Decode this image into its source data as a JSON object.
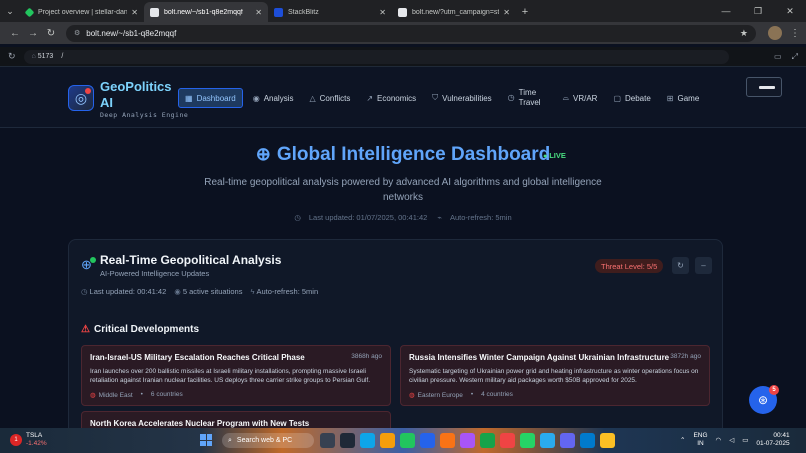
{
  "browser": {
    "tabs": [
      {
        "title": "Project overview | stellar-dange",
        "favicon_color": "#22c55e",
        "active": false
      },
      {
        "title": "bolt.new/~/sb1-q8e2mqqf",
        "favicon_color": "#e5e7eb",
        "active": true
      },
      {
        "title": "StackBlitz",
        "favicon_color": "#1d4ed8",
        "active": false
      },
      {
        "title": "bolt.new/?utm_campaign=stac",
        "favicon_color": "#e5e7eb",
        "active": false
      }
    ],
    "url": "bolt.new/~/sb1-q8e2mqqf"
  },
  "preview": {
    "port": "5173",
    "path": "/"
  },
  "app": {
    "brand_title": "GeoPolitics AI",
    "brand_subtitle": "Deep Analysis Engine",
    "nav": [
      {
        "label": "Dashboard",
        "icon": "grid-icon",
        "active": true
      },
      {
        "label": "Analysis",
        "icon": "brain-icon",
        "active": false
      },
      {
        "label": "Conflicts",
        "icon": "warning-icon",
        "active": false
      },
      {
        "label": "Economics",
        "icon": "trend-icon",
        "active": false
      },
      {
        "label": "Vulnerabilities",
        "icon": "shield-icon",
        "active": false
      },
      {
        "label": "Time Travel",
        "icon": "clock-icon",
        "active": false
      },
      {
        "label": "VR/AR",
        "icon": "headset-icon",
        "active": false
      },
      {
        "label": "Debate",
        "icon": "chat-icon",
        "active": false
      },
      {
        "label": "Game",
        "icon": "gamepad-icon",
        "active": false
      }
    ]
  },
  "hero": {
    "title": "Global Intelligence Dashboard",
    "live": "LIVE",
    "description": "Real-time geopolitical analysis powered by advanced AI algorithms and global intelligence networks",
    "last_updated": "Last updated: 01/07/2025, 00:41:42",
    "auto_refresh": "Auto-refresh: 5min"
  },
  "panel": {
    "title": "Real-Time Geopolitical Analysis",
    "subtitle": "AI-Powered Intelligence Updates",
    "threat": "Threat Level: 5/5",
    "last_updated": "Last updated: 00:41:42",
    "situations": "5 active situations",
    "auto_refresh": "Auto-refresh: 5min",
    "critical_title": "Critical Developments",
    "cards": [
      {
        "title": "Iran-Israel-US Military Escalation Reaches Critical Phase",
        "age": "3868h ago",
        "description": "Iran launches over 200 ballistic missiles at Israeli military installations, prompting massive Israeli retaliation against Iranian nuclear facilities. US deploys three carrier strike groups to Persian Gulf.",
        "region": "Middle East",
        "countries": "6 countries"
      },
      {
        "title": "Russia Intensifies Winter Campaign Against Ukrainian Infrastructure",
        "age": "3872h ago",
        "description": "Systematic targeting of Ukrainian power grid and heating infrastructure as winter operations focus on civilian pressure. Western military aid packages worth $50B approved for 2025.",
        "region": "Eastern Europe",
        "countries": "4 countries"
      }
    ],
    "partial_card_title": "North Korea Accelerates Nuclear Program with New Tests"
  },
  "fab": {
    "badge": "5"
  },
  "taskbar": {
    "stock_symbol": "TSLA",
    "stock_change": "-1.42%",
    "stock_badge": "1",
    "search_placeholder": "Search web & PC",
    "lang_top": "ENG",
    "lang_bottom": "IN",
    "time": "00:41",
    "date": "01-07-2025"
  }
}
